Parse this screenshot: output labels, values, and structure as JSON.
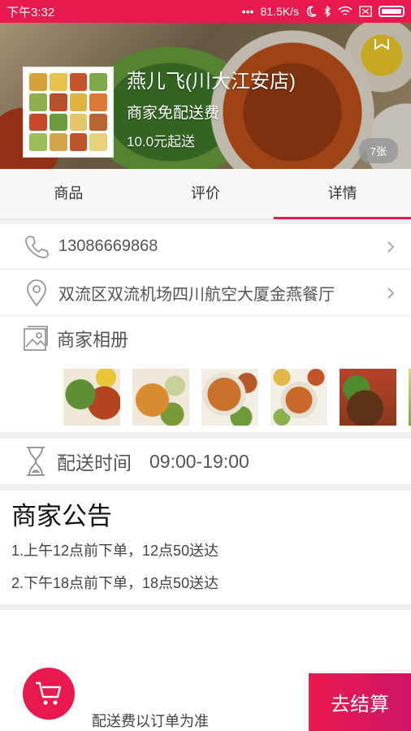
{
  "status_bar": {
    "time": "下午3:32",
    "speed": "81.5K/s"
  },
  "shop": {
    "name": "燕儿飞(川大江安店)",
    "delivery_fee": "商家免配送费",
    "min_order": "10.0元起送",
    "photo_count": "7张"
  },
  "tabs": [
    {
      "label": "商品"
    },
    {
      "label": "评价"
    },
    {
      "label": "详情",
      "active": true
    }
  ],
  "details": {
    "phone": "13086669868",
    "address": "双流区双流机场四川航空大厦金燕餐厅",
    "album_title": "商家相册",
    "delivery_time_label": "配送时间",
    "delivery_time_value": "09:00-19:00"
  },
  "notice": {
    "title": "商家公告",
    "lines": [
      "1.上午12点前下单，12点50送达",
      "2.下午18点前下单，18点50送达"
    ]
  },
  "bottom": {
    "fee_note": "配送费以订单为准",
    "checkout_label": "去结算"
  },
  "colors": {
    "accent": "#e8194f"
  }
}
